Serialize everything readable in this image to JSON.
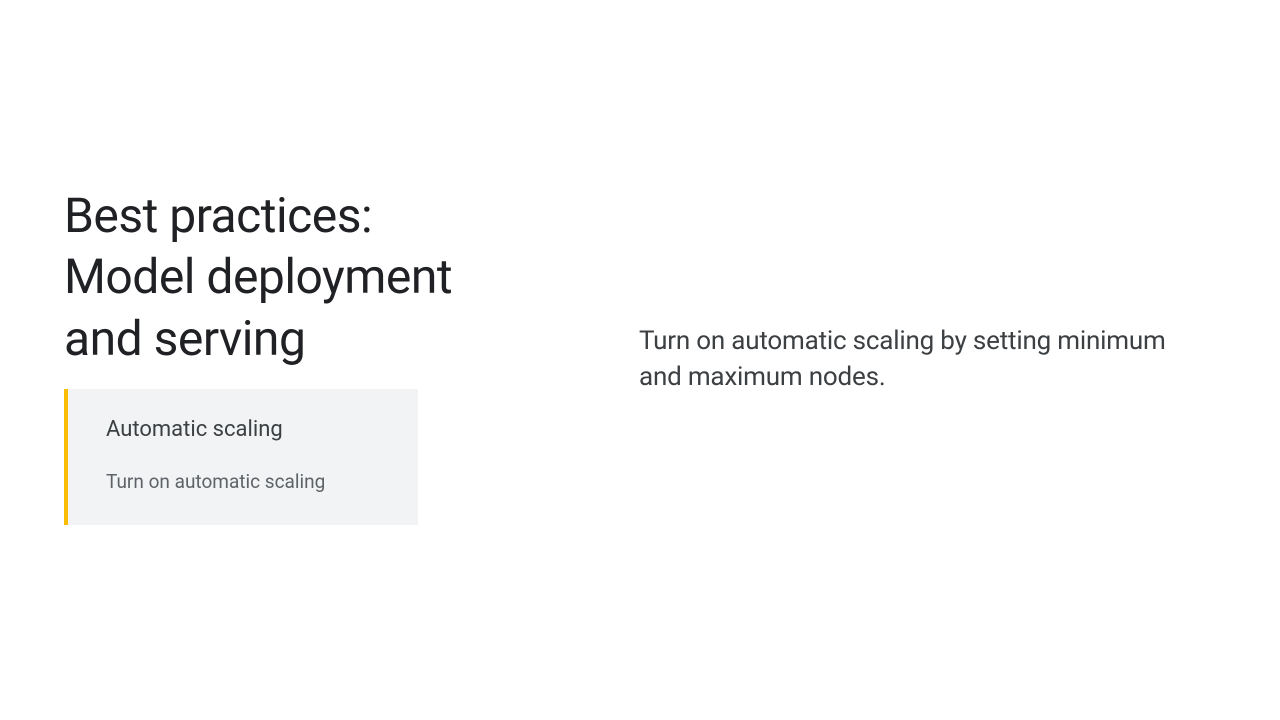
{
  "heading": {
    "line1": "Best practices:",
    "line2": "Model deployment",
    "line3": "and serving"
  },
  "callout": {
    "title": "Automatic scaling",
    "subtitle": "Turn on automatic scaling"
  },
  "body": {
    "text": "Turn on automatic scaling by setting minimum and maximum nodes."
  },
  "colors": {
    "accent": "#fbbc04",
    "card_bg": "#f1f3f4",
    "heading_text": "#202124",
    "body_text": "#3c4043",
    "muted_text": "#5f6368"
  }
}
